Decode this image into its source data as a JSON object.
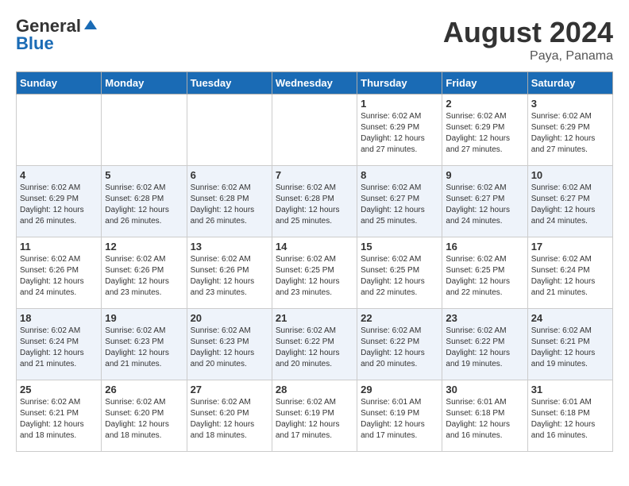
{
  "header": {
    "logo_general": "General",
    "logo_blue": "Blue",
    "month_year": "August 2024",
    "location": "Paya, Panama"
  },
  "weekdays": [
    "Sunday",
    "Monday",
    "Tuesday",
    "Wednesday",
    "Thursday",
    "Friday",
    "Saturday"
  ],
  "weeks": [
    [
      {
        "day": "",
        "info": ""
      },
      {
        "day": "",
        "info": ""
      },
      {
        "day": "",
        "info": ""
      },
      {
        "day": "",
        "info": ""
      },
      {
        "day": "1",
        "info": "Sunrise: 6:02 AM\nSunset: 6:29 PM\nDaylight: 12 hours\nand 27 minutes."
      },
      {
        "day": "2",
        "info": "Sunrise: 6:02 AM\nSunset: 6:29 PM\nDaylight: 12 hours\nand 27 minutes."
      },
      {
        "day": "3",
        "info": "Sunrise: 6:02 AM\nSunset: 6:29 PM\nDaylight: 12 hours\nand 27 minutes."
      }
    ],
    [
      {
        "day": "4",
        "info": "Sunrise: 6:02 AM\nSunset: 6:29 PM\nDaylight: 12 hours\nand 26 minutes."
      },
      {
        "day": "5",
        "info": "Sunrise: 6:02 AM\nSunset: 6:28 PM\nDaylight: 12 hours\nand 26 minutes."
      },
      {
        "day": "6",
        "info": "Sunrise: 6:02 AM\nSunset: 6:28 PM\nDaylight: 12 hours\nand 26 minutes."
      },
      {
        "day": "7",
        "info": "Sunrise: 6:02 AM\nSunset: 6:28 PM\nDaylight: 12 hours\nand 25 minutes."
      },
      {
        "day": "8",
        "info": "Sunrise: 6:02 AM\nSunset: 6:27 PM\nDaylight: 12 hours\nand 25 minutes."
      },
      {
        "day": "9",
        "info": "Sunrise: 6:02 AM\nSunset: 6:27 PM\nDaylight: 12 hours\nand 24 minutes."
      },
      {
        "day": "10",
        "info": "Sunrise: 6:02 AM\nSunset: 6:27 PM\nDaylight: 12 hours\nand 24 minutes."
      }
    ],
    [
      {
        "day": "11",
        "info": "Sunrise: 6:02 AM\nSunset: 6:26 PM\nDaylight: 12 hours\nand 24 minutes."
      },
      {
        "day": "12",
        "info": "Sunrise: 6:02 AM\nSunset: 6:26 PM\nDaylight: 12 hours\nand 23 minutes."
      },
      {
        "day": "13",
        "info": "Sunrise: 6:02 AM\nSunset: 6:26 PM\nDaylight: 12 hours\nand 23 minutes."
      },
      {
        "day": "14",
        "info": "Sunrise: 6:02 AM\nSunset: 6:25 PM\nDaylight: 12 hours\nand 23 minutes."
      },
      {
        "day": "15",
        "info": "Sunrise: 6:02 AM\nSunset: 6:25 PM\nDaylight: 12 hours\nand 22 minutes."
      },
      {
        "day": "16",
        "info": "Sunrise: 6:02 AM\nSunset: 6:25 PM\nDaylight: 12 hours\nand 22 minutes."
      },
      {
        "day": "17",
        "info": "Sunrise: 6:02 AM\nSunset: 6:24 PM\nDaylight: 12 hours\nand 21 minutes."
      }
    ],
    [
      {
        "day": "18",
        "info": "Sunrise: 6:02 AM\nSunset: 6:24 PM\nDaylight: 12 hours\nand 21 minutes."
      },
      {
        "day": "19",
        "info": "Sunrise: 6:02 AM\nSunset: 6:23 PM\nDaylight: 12 hours\nand 21 minutes."
      },
      {
        "day": "20",
        "info": "Sunrise: 6:02 AM\nSunset: 6:23 PM\nDaylight: 12 hours\nand 20 minutes."
      },
      {
        "day": "21",
        "info": "Sunrise: 6:02 AM\nSunset: 6:22 PM\nDaylight: 12 hours\nand 20 minutes."
      },
      {
        "day": "22",
        "info": "Sunrise: 6:02 AM\nSunset: 6:22 PM\nDaylight: 12 hours\nand 20 minutes."
      },
      {
        "day": "23",
        "info": "Sunrise: 6:02 AM\nSunset: 6:22 PM\nDaylight: 12 hours\nand 19 minutes."
      },
      {
        "day": "24",
        "info": "Sunrise: 6:02 AM\nSunset: 6:21 PM\nDaylight: 12 hours\nand 19 minutes."
      }
    ],
    [
      {
        "day": "25",
        "info": "Sunrise: 6:02 AM\nSunset: 6:21 PM\nDaylight: 12 hours\nand 18 minutes."
      },
      {
        "day": "26",
        "info": "Sunrise: 6:02 AM\nSunset: 6:20 PM\nDaylight: 12 hours\nand 18 minutes."
      },
      {
        "day": "27",
        "info": "Sunrise: 6:02 AM\nSunset: 6:20 PM\nDaylight: 12 hours\nand 18 minutes."
      },
      {
        "day": "28",
        "info": "Sunrise: 6:02 AM\nSunset: 6:19 PM\nDaylight: 12 hours\nand 17 minutes."
      },
      {
        "day": "29",
        "info": "Sunrise: 6:01 AM\nSunset: 6:19 PM\nDaylight: 12 hours\nand 17 minutes."
      },
      {
        "day": "30",
        "info": "Sunrise: 6:01 AM\nSunset: 6:18 PM\nDaylight: 12 hours\nand 16 minutes."
      },
      {
        "day": "31",
        "info": "Sunrise: 6:01 AM\nSunset: 6:18 PM\nDaylight: 12 hours\nand 16 minutes."
      }
    ]
  ]
}
